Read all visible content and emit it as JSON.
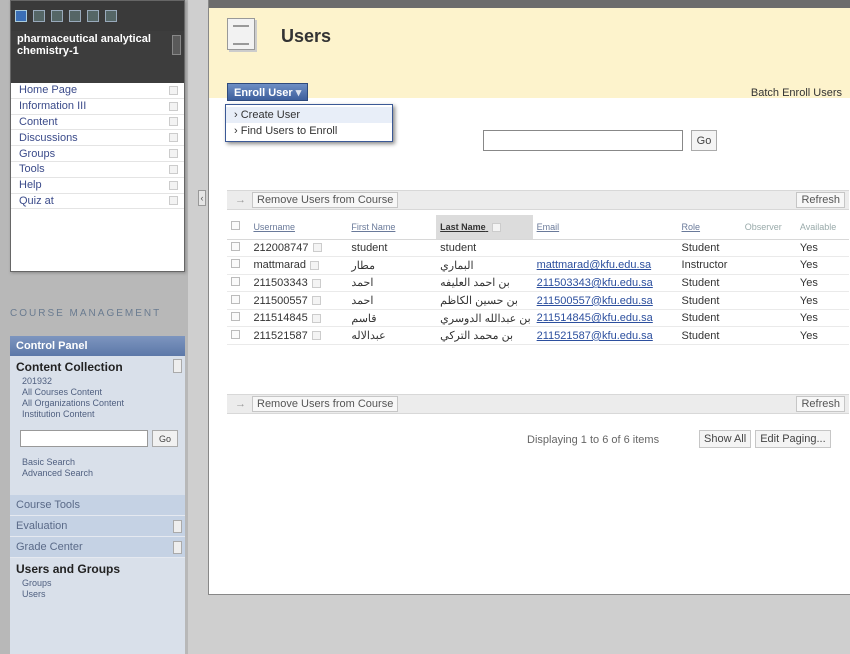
{
  "left_menu": {
    "course_title": "pharmaceutical analytical chemistry-1",
    "items": [
      {
        "label": "Home Page"
      },
      {
        "label": "Information III"
      },
      {
        "label": "Content"
      },
      {
        "label": "Discussions"
      },
      {
        "label": "Groups"
      },
      {
        "label": "Tools"
      },
      {
        "label": "Help"
      },
      {
        "label": "Quiz at"
      }
    ]
  },
  "course_management": {
    "header": "COURSE MANAGEMENT",
    "control_panel": "Control Panel",
    "content_collection": {
      "title": "Content Collection",
      "links": [
        "201932",
        "All Courses Content",
        "All Organizations Content",
        "Institution Content"
      ]
    },
    "search_go": "Go",
    "search_links": [
      "Basic Search",
      "Advanced Search"
    ],
    "tools": [
      "Course Tools",
      "Evaluation",
      "Grade Center"
    ],
    "users_and_groups": {
      "title": "Users and Groups",
      "links": [
        "Groups",
        "Users"
      ]
    }
  },
  "header": {
    "title": "Users",
    "enroll_button": "Enroll User",
    "batch_link": "Batch Enroll Users"
  },
  "enroll_menu": {
    "options": [
      "Create User",
      "Find Users to Enroll"
    ]
  },
  "search": {
    "go": "Go"
  },
  "action_bar": {
    "remove": "Remove Users from Course",
    "refresh": "Refresh"
  },
  "table": {
    "headers": [
      "Username",
      "First Name",
      "Last Name",
      "Email",
      "Role",
      "Observer",
      "Available"
    ],
    "rows": [
      {
        "username": "212008747",
        "first": "student",
        "last": "student",
        "email": "",
        "role": "Student",
        "available": "Yes"
      },
      {
        "username": "mattmarad",
        "first": "مطار",
        "last": "البماري",
        "email": "mattmarad@kfu.edu.sa",
        "role": "Instructor",
        "available": "Yes"
      },
      {
        "username": "211503343",
        "first": "احمد",
        "last": "بن احمد العليفه",
        "email": "211503343@kfu.edu.sa",
        "role": "Student",
        "available": "Yes"
      },
      {
        "username": "211500557",
        "first": "احمد",
        "last": "بن حسين الكاظم",
        "email": "211500557@kfu.edu.sa",
        "role": "Student",
        "available": "Yes"
      },
      {
        "username": "211514845",
        "first": "قاسم",
        "last": "بن عبدالله الدوسري",
        "email": "211514845@kfu.edu.sa",
        "role": "Student",
        "available": "Yes"
      },
      {
        "username": "211521587",
        "first": "عبدالاله",
        "last": "بن محمد التركي",
        "email": "211521587@kfu.edu.sa",
        "role": "Student",
        "available": "Yes"
      }
    ]
  },
  "paging": {
    "info": "Displaying 1 to 6 of 6 items",
    "show_all": "Show All",
    "edit_paging": "Edit Paging..."
  }
}
